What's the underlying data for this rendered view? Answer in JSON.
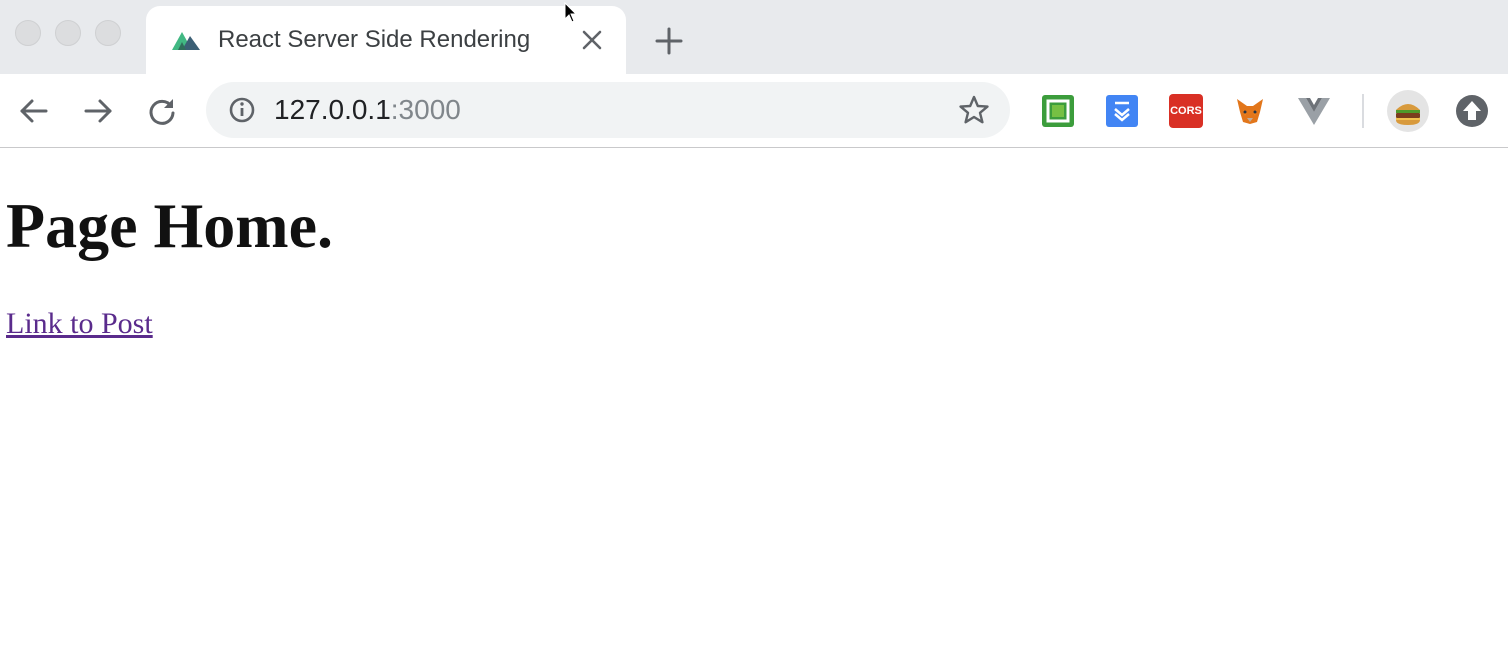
{
  "browser": {
    "tab": {
      "title": "React Server Side Rendering",
      "favicon": "nuxt-mountain-icon"
    },
    "address_bar": {
      "host": "127.0.0.1",
      "port": ":3000"
    },
    "icons": {
      "back": "back-arrow-icon",
      "forward": "forward-arrow-icon",
      "reload": "reload-icon",
      "info": "info-icon",
      "bookmark": "star-icon",
      "update": "update-arrow-icon"
    },
    "extensions": [
      {
        "name": "green-square-extension-icon",
        "color": "#3c9d3c"
      },
      {
        "name": "blue-download-extension-icon",
        "color": "#4285f4"
      },
      {
        "name": "cors-extension-icon",
        "label": "CORS",
        "color": "#d93025"
      },
      {
        "name": "metamask-fox-extension-icon",
        "color": "#e2761b"
      },
      {
        "name": "vue-devtools-extension-icon",
        "color": "#9aa0a6"
      }
    ]
  },
  "page": {
    "heading": "Page Home.",
    "link_label": "Link to Post",
    "link_color": "#5a2b8c"
  }
}
